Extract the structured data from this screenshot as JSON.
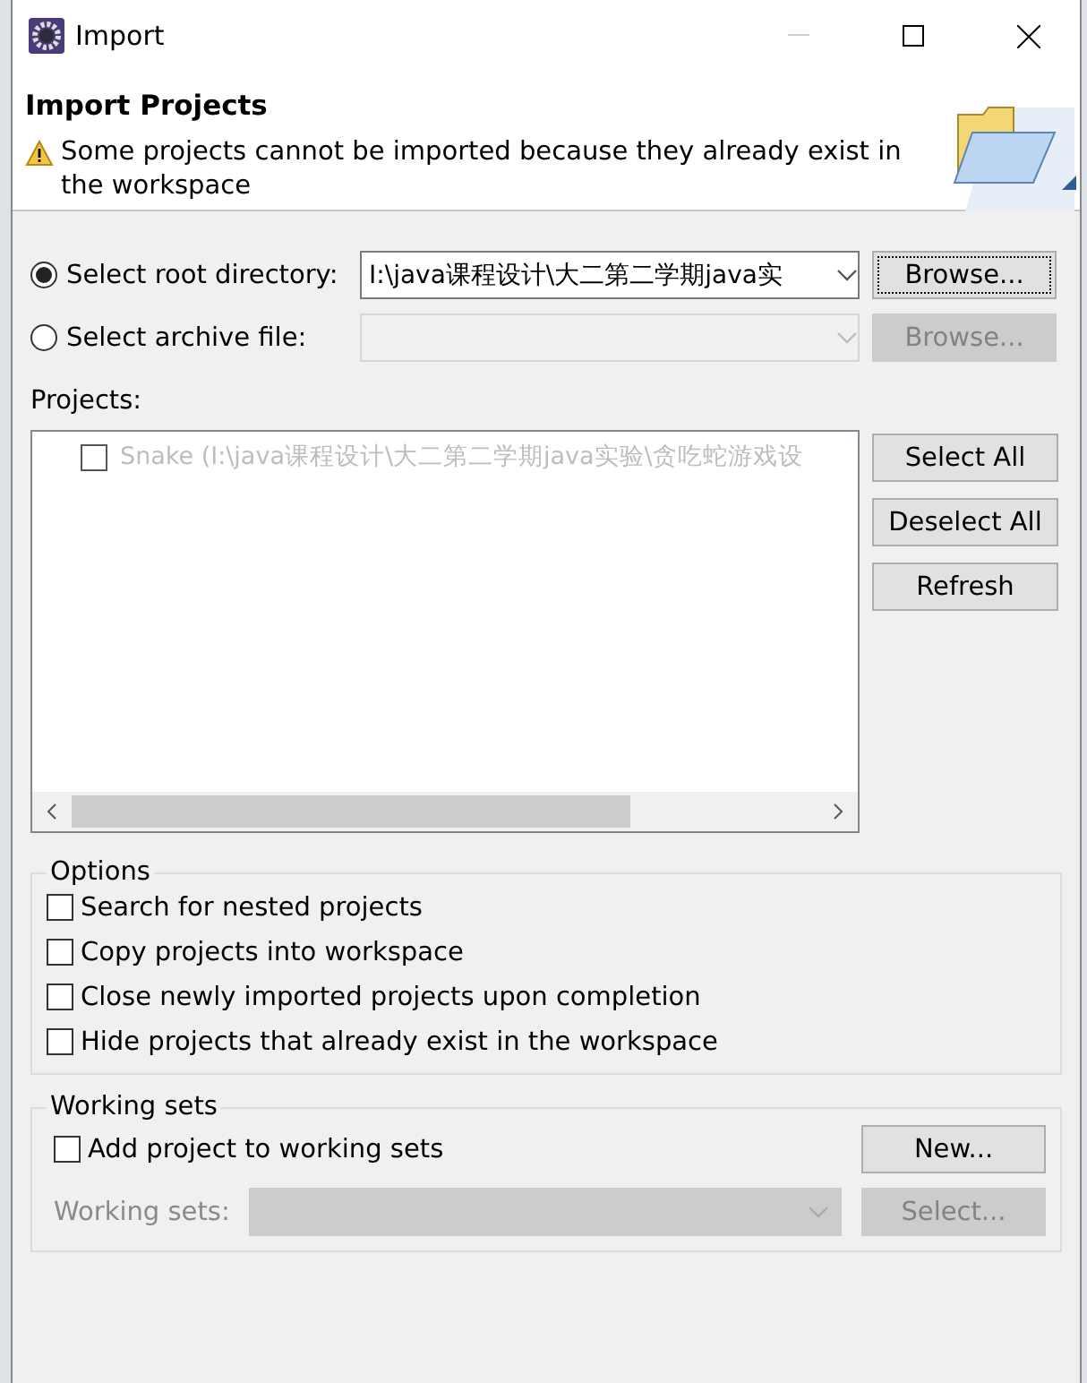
{
  "window": {
    "title": "Import"
  },
  "header": {
    "title": "Import Projects",
    "message": "Some projects cannot be imported because they already exist in the workspace"
  },
  "source": [
    {
      "label": "Select root directory:",
      "selected": true,
      "disabled": false,
      "value": "I:\\java课程设计\\大二第二学期java实",
      "button": "Browse..."
    },
    {
      "label": "Select archive file:",
      "selected": false,
      "disabled": true,
      "button": "Browse..."
    }
  ],
  "projects": {
    "label": "Projects:",
    "items": [
      {
        "name": "Snake (I:\\java课程设计\\大二第二学期java实验\\贪吃蛇游戏设",
        "checked": false,
        "disabled": true
      }
    ],
    "buttons": [
      "Select All",
      "Deselect All",
      "Refresh"
    ]
  },
  "options": {
    "title": "Options",
    "items": [
      {
        "label": "Search for nested projects",
        "checked": false
      },
      {
        "label": "Copy projects into workspace",
        "checked": false
      },
      {
        "label": "Close newly imported projects upon completion",
        "checked": false
      },
      {
        "label": "Hide projects that already exist in the workspace",
        "checked": false
      }
    ]
  },
  "working_sets": {
    "title": "Working sets",
    "checkbox": {
      "label": "Add project to working sets",
      "checked": false
    },
    "new_button": "New...",
    "field_label": "Working sets:",
    "disabled": true,
    "select_button": "Select..."
  }
}
